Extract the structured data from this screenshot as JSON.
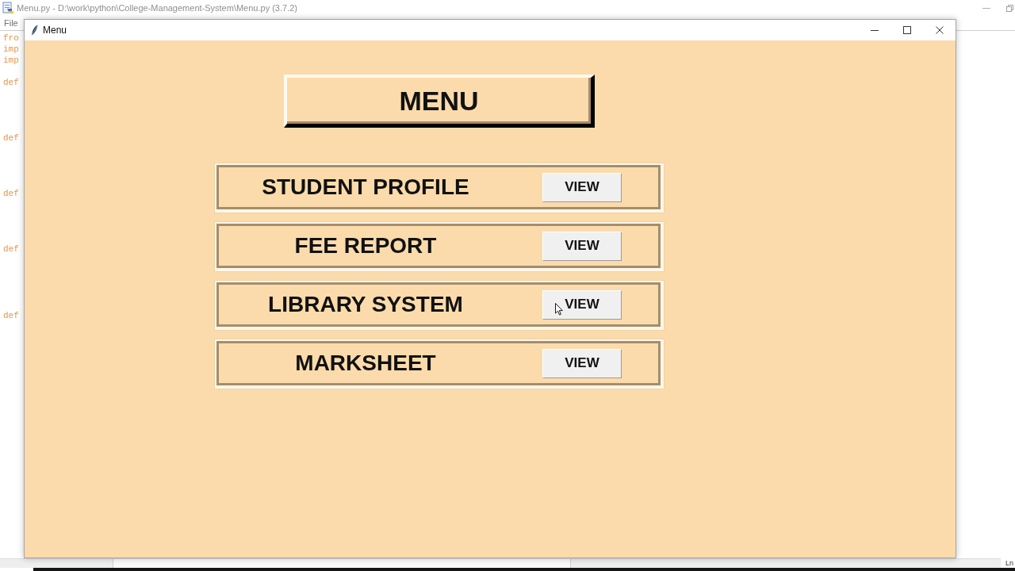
{
  "editor_window": {
    "title": "Menu.py - D:\\work\\python\\College-Management-System\\Menu.py (3.7.2)",
    "menu": [
      "File"
    ],
    "code_lines": [
      "fro",
      "imp",
      "imp",
      "def",
      "def",
      "def",
      "def",
      "def"
    ],
    "status_bar": "Ln"
  },
  "menu_window": {
    "title": "Menu",
    "heading": "MENU",
    "options": [
      {
        "label": "STUDENT PROFILE",
        "button": "VIEW",
        "pointer_over": false
      },
      {
        "label": "FEE REPORT",
        "button": "VIEW",
        "pointer_over": false
      },
      {
        "label": "LIBRARY SYSTEM",
        "button": "VIEW",
        "pointer_over": true
      },
      {
        "label": "MARKSHEET",
        "button": "VIEW",
        "pointer_over": false
      }
    ]
  }
}
